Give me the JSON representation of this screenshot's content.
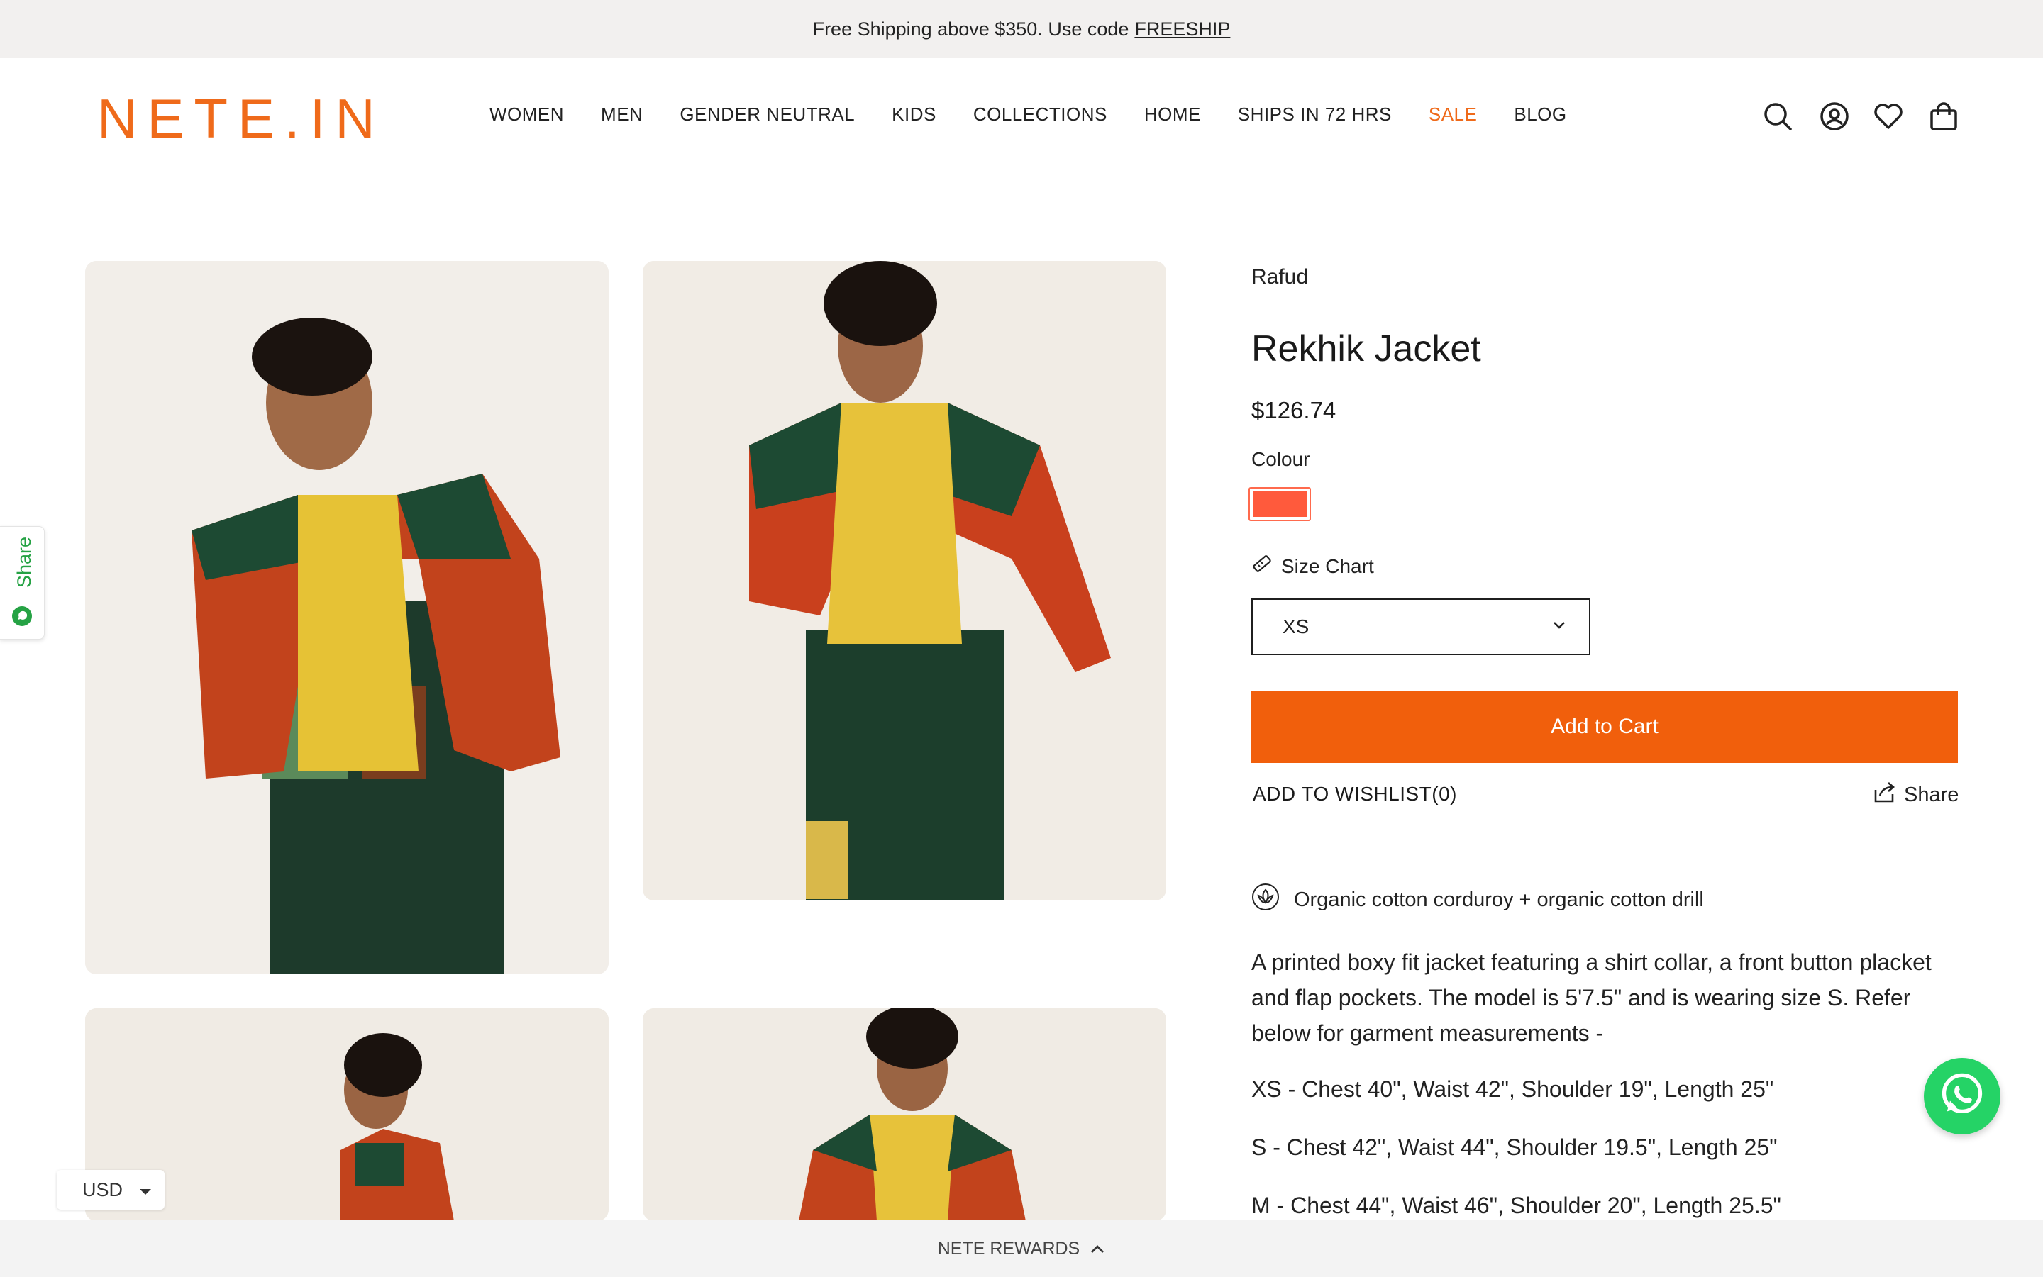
{
  "announcement": {
    "text": "Free Shipping above $350. Use code",
    "code": "FREESHIP"
  },
  "header": {
    "logo": "NETE.IN",
    "nav": [
      "WOMEN",
      "MEN",
      "GENDER NEUTRAL",
      "KIDS",
      "COLLECTIONS",
      "HOME",
      "SHIPS IN 72 HRS",
      "SALE",
      "BLOG"
    ],
    "icons": [
      "search-icon",
      "account-icon",
      "heart-icon",
      "bag-icon"
    ]
  },
  "sidebar_share": {
    "label": "Share",
    "icon": "whatsapp-icon"
  },
  "product": {
    "vendor": "Rafud",
    "title": "Rekhik Jacket",
    "price": "$126.74",
    "colour_label": "Colour",
    "swatch_color": "#ff5a3c",
    "size_chart_label": "Size Chart",
    "size_selected": "XS",
    "add_to_cart": "Add to Cart",
    "wishlist_label": "ADD TO WISHLIST(0)",
    "share_label": "Share",
    "material": "Organic cotton corduroy + organic cotton drill",
    "description": "A printed boxy fit jacket featuring a shirt collar, a front button placket and flap pockets. The model is 5'7.5\" and is wearing size S. Refer below for garment measurements -",
    "measurements": [
      "XS - Chest 40\", Waist 42\", Shoulder 19\", Length 25\"",
      "S - Chest 42\", Waist 44\", Shoulder 19.5\", Length 25\"",
      "M - Chest 44\", Waist 46\", Shoulder 20\", Length 25.5\""
    ]
  },
  "colors": {
    "accent": "#ef6a1a",
    "button": "#f15f0c",
    "whatsapp": "#25d366"
  },
  "currency": "USD",
  "rewards": "NETE REWARDS"
}
